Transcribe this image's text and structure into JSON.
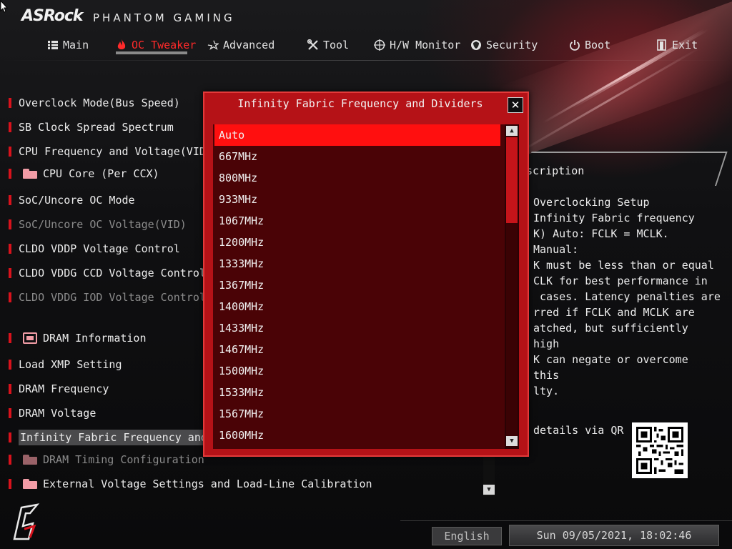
{
  "header": {
    "brand": "ASRock",
    "brand_sub": "PHANTOM GAMING"
  },
  "tabs": [
    {
      "label": "Main",
      "icon": "list-icon",
      "active": false
    },
    {
      "label": "OC Tweaker",
      "icon": "flame-icon",
      "active": true
    },
    {
      "label": "Advanced",
      "icon": "star-icon",
      "active": false
    },
    {
      "label": "Tool",
      "icon": "wrench-icon",
      "active": false
    },
    {
      "label": "H/W Monitor",
      "icon": "crosshair-icon",
      "active": false
    },
    {
      "label": "Security",
      "icon": "shield-icon",
      "active": false
    },
    {
      "label": "Boot",
      "icon": "power-icon",
      "active": false
    },
    {
      "label": "Exit",
      "icon": "exit-icon",
      "active": false
    }
  ],
  "menu": {
    "items": [
      {
        "label": "Overclock Mode(Bus Speed)",
        "type": "item"
      },
      {
        "label": "SB Clock Spread Spectrum",
        "type": "item"
      },
      {
        "label": "CPU Frequency and Voltage(VID) Ch",
        "type": "item"
      },
      {
        "label": "CPU Core (Per CCX)",
        "type": "folder"
      },
      {
        "label": "SoC/Uncore OC Mode",
        "type": "item"
      },
      {
        "label": "SoC/Uncore OC Voltage(VID)",
        "type": "disabled"
      },
      {
        "label": "CLDO VDDP Voltage Control",
        "type": "item"
      },
      {
        "label": "CLDO VDDG CCD Voltage Control",
        "type": "item"
      },
      {
        "label": "CLDO VDDG IOD Voltage Control",
        "type": "disabled"
      },
      {
        "label": "DRAM Information",
        "type": "dram"
      },
      {
        "label": "Load XMP Setting",
        "type": "item"
      },
      {
        "label": "DRAM Frequency",
        "type": "item"
      },
      {
        "label": "DRAM Voltage",
        "type": "item"
      },
      {
        "label": "Infinity Fabric Frequency and Di",
        "type": "selected"
      },
      {
        "label": "DRAM Timing Configuration",
        "type": "folder-dim"
      },
      {
        "label": "External Voltage Settings and Load-Line Calibration",
        "type": "folder"
      }
    ]
  },
  "description": {
    "title": "scription",
    "lines": [
      "Overclocking Setup",
      "Infinity Fabric frequency",
      "K) Auto: FCLK = MCLK. Manual:",
      "K must be less than or equal",
      "CLK for best performance in",
      " cases. Latency penalties are",
      "rred if FCLK and MCLK are",
      "atched, but sufficiently high",
      "K can negate or overcome this",
      "lty."
    ],
    "qr_label": "details via QR"
  },
  "dialog": {
    "title": "Infinity Fabric Frequency and Dividers",
    "close": "✕",
    "options": [
      "Auto",
      "667MHz",
      "800MHz",
      "933MHz",
      "1067MHz",
      "1200MHz",
      "1333MHz",
      "1367MHz",
      "1400MHz",
      "1433MHz",
      "1467MHz",
      "1500MHz",
      "1533MHz",
      "1567MHz",
      "1600MHz"
    ],
    "selected": "Auto"
  },
  "footer": {
    "language": "English",
    "datetime": "Sun 09/05/2021, 18:02:46"
  },
  "colors": {
    "accent": "#ff2a2a",
    "dialog_bg": "#b51217",
    "list_bg": "#4a0306",
    "selected_bg": "#ff0f0f"
  }
}
